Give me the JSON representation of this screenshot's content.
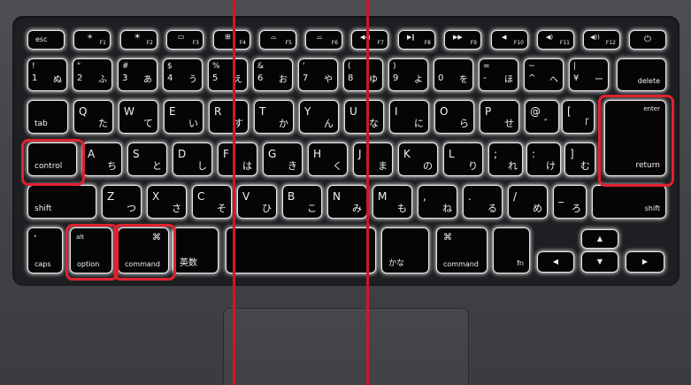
{
  "keyboard": {
    "fn_row": [
      {
        "label": "esc",
        "icon": ""
      },
      {
        "label": "F1",
        "icon": "☀"
      },
      {
        "label": "F2",
        "icon": "☀"
      },
      {
        "label": "F3",
        "icon": "▭"
      },
      {
        "label": "F4",
        "icon": "⊞"
      },
      {
        "label": "F5",
        "icon": "⌓"
      },
      {
        "label": "F6",
        "icon": "⌓"
      },
      {
        "label": "F7",
        "icon": "◀◀"
      },
      {
        "label": "F8",
        "icon": "▶‖"
      },
      {
        "label": "F9",
        "icon": "▶▶"
      },
      {
        "label": "F10",
        "icon": "◀"
      },
      {
        "label": "F11",
        "icon": "◀)"
      },
      {
        "label": "F12",
        "icon": "◀))"
      },
      {
        "label": "",
        "icon": "⏻"
      }
    ],
    "number_row": [
      {
        "top": "!",
        "num": "1",
        "kana": "ぬ"
      },
      {
        "top": "\"",
        "num": "2",
        "kana": "ふ"
      },
      {
        "top": "#",
        "num": "3",
        "kana": "あ"
      },
      {
        "top": "$",
        "num": "4",
        "kana": "う"
      },
      {
        "top": "%",
        "num": "5",
        "kana": "え"
      },
      {
        "top": "&",
        "num": "6",
        "kana": "お"
      },
      {
        "top": "'",
        "num": "7",
        "kana": "や"
      },
      {
        "top": "(",
        "num": "8",
        "kana": "ゆ"
      },
      {
        "top": ")",
        "num": "9",
        "kana": "よ"
      },
      {
        "top": "",
        "num": "0",
        "kana": "を"
      },
      {
        "top": "=",
        "num": "-",
        "kana": "ほ"
      },
      {
        "top": "~",
        "num": "^",
        "kana": "へ"
      },
      {
        "top": "|",
        "num": "¥",
        "kana": "ー"
      }
    ],
    "delete_label": "delete",
    "tab_label": "tab",
    "q_row": [
      {
        "l": "Q",
        "k": "た"
      },
      {
        "l": "W",
        "k": "て"
      },
      {
        "l": "E",
        "k": "い"
      },
      {
        "l": "R",
        "k": "す"
      },
      {
        "l": "T",
        "k": "か"
      },
      {
        "l": "Y",
        "k": "ん"
      },
      {
        "l": "U",
        "k": "な"
      },
      {
        "l": "I",
        "k": "に"
      },
      {
        "l": "O",
        "k": "ら"
      },
      {
        "l": "P",
        "k": "せ"
      },
      {
        "l": "@",
        "k": "゛"
      },
      {
        "l": "[",
        "k": "「"
      }
    ],
    "enter_label": "enter",
    "return_label": "return",
    "control_label": "control",
    "a_row": [
      {
        "l": "A",
        "k": "ち"
      },
      {
        "l": "S",
        "k": "と"
      },
      {
        "l": "D",
        "k": "し"
      },
      {
        "l": "F",
        "k": "は"
      },
      {
        "l": "G",
        "k": "き"
      },
      {
        "l": "H",
        "k": "く"
      },
      {
        "l": "J",
        "k": "ま"
      },
      {
        "l": "K",
        "k": "の"
      },
      {
        "l": "L",
        "k": "り"
      },
      {
        "l": ";",
        "k": "れ"
      },
      {
        "l": ":",
        "k": "け"
      },
      {
        "l": "]",
        "k": "む"
      }
    ],
    "shift_label": "shift",
    "z_row": [
      {
        "l": "Z",
        "k": "つ"
      },
      {
        "l": "X",
        "k": "さ"
      },
      {
        "l": "C",
        "k": "そ"
      },
      {
        "l": "V",
        "k": "ひ"
      },
      {
        "l": "B",
        "k": "こ"
      },
      {
        "l": "N",
        "k": "み"
      },
      {
        "l": "M",
        "k": "も"
      },
      {
        "l": ",",
        "k": "ね"
      },
      {
        "l": ".",
        "k": "る"
      },
      {
        "l": "/",
        "k": "め"
      },
      {
        "l": "_",
        "k": "ろ"
      }
    ],
    "caps_label": "caps",
    "alt_label": "alt",
    "option_label": "option",
    "command_symbol": "⌘",
    "command_label": "command",
    "eisu_label": "英数",
    "kana_label": "かな",
    "fn_label": "fn",
    "arrow_up": "▲",
    "arrow_down": "▼",
    "arrow_left": "◀",
    "arrow_right": "▶"
  },
  "colors": {
    "highlight": "#e2212f",
    "backlight": "#ffffff",
    "body": "#45464a"
  }
}
